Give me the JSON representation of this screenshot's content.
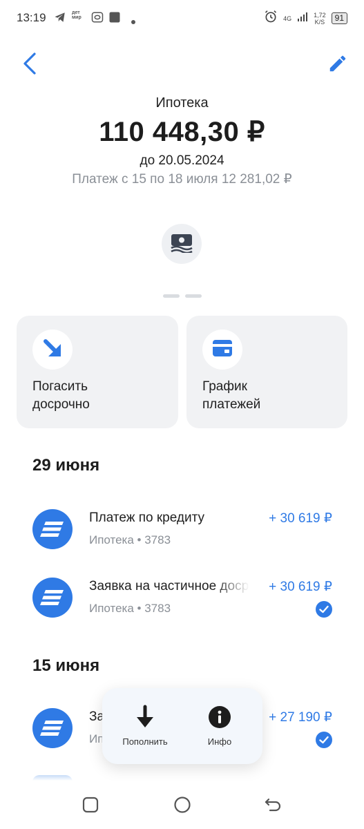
{
  "status_bar": {
    "time": "13:19",
    "store_icon_label": "дет мир",
    "network_type": "4G",
    "net_speed_value": "1,72",
    "net_speed_unit": "K/S",
    "battery": "91"
  },
  "header": {
    "back_icon": "chevron-left-icon",
    "edit_icon": "pencil-icon"
  },
  "loan": {
    "title": "Ипотека",
    "amount": "110 448,30 ₽",
    "until": "до 20.05.2024",
    "payment_info": "Платеж с 15 по 18 июля 12 281,02 ₽",
    "card_icon": "banknote-icon"
  },
  "actions": {
    "repay_line1": "Погасить",
    "repay_line2": "досрочно",
    "schedule_line1": "График",
    "schedule_line2": "платежей"
  },
  "sections": [
    {
      "date": "29 июня",
      "transactions": [
        {
          "title": "Платеж по кредиту",
          "subtitle": "Ипотека • 3783",
          "amount": "+ 30 619 ₽"
        },
        {
          "title": "Заявка на частичное досрочное погашение",
          "subtitle": "Ипотека • 3783",
          "amount": "+ 30 619 ₽"
        }
      ]
    },
    {
      "date": "15 июня",
      "transactions": [
        {
          "title": "За",
          "subtitle": "Ип",
          "amount": "+ 27 190 ₽"
        }
      ]
    }
  ],
  "float_menu": {
    "topup_label": "Пополнить",
    "info_label": "Инфо"
  },
  "colors": {
    "accent": "#2f7ae5",
    "muted_text": "#8a8f96",
    "tile_bg": "#f1f2f4"
  }
}
